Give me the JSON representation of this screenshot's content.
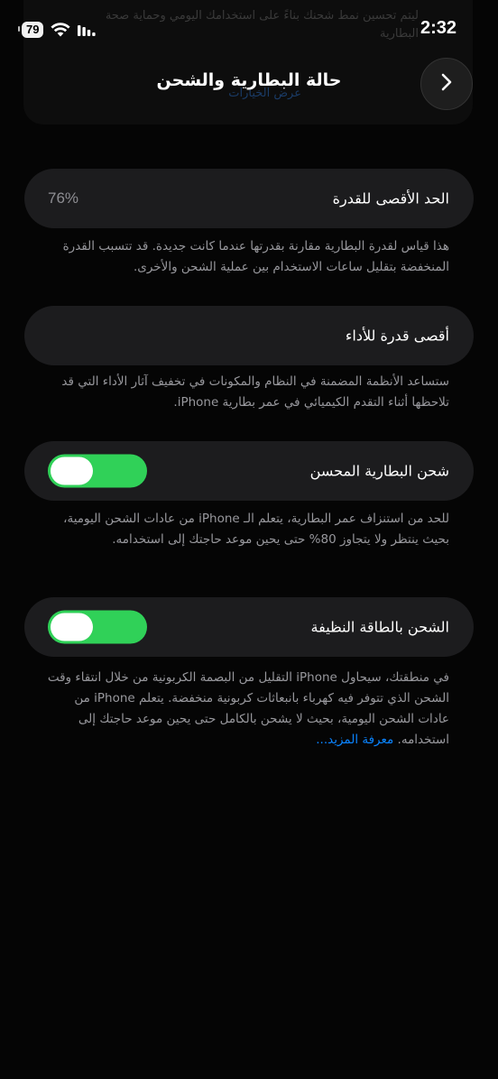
{
  "status_bar": {
    "time": "2:32",
    "battery_level": "79"
  },
  "backdrop": {
    "text": "ليتم تحسين نمط شحنك بناءً على استخدامك اليومي وحماية صحة البطارية",
    "link": "عرض الخيارات"
  },
  "header": {
    "title": "حالة البطارية والشحن"
  },
  "max_capacity": {
    "label": "الحد الأقصى للقدرة",
    "value": "76%",
    "note": "هذا قياس لقدرة البطارية مقارنة بقدرتها عندما كانت جديدة. قد تتسبب القدرة المنخفضة بتقليل ساعات الاستخدام بين عملية الشحن والأخرى."
  },
  "peak_performance": {
    "label": "أقصى قدرة للأداء",
    "note": "ستساعد الأنظمة المضمنة في النظام والمكونات في تخفيف آثار الأداء التي قد تلاحظها أثناء التقدم الكيميائي في عمر بطارية iPhone."
  },
  "optimized_charging": {
    "label": "شحن البطارية المحسن",
    "enabled": true,
    "note": "للحد من استنزاف عمر البطارية، يتعلم الـ iPhone من عادات الشحن اليومية، بحيث ينتظر ولا يتجاوز 80% حتى يحين موعد حاجتك إلى استخدامه."
  },
  "clean_energy": {
    "label": "الشحن بالطاقة النظيفة",
    "enabled": true,
    "note": "في منطقتك، سيحاول iPhone التقليل من البصمة الكربونية من خلال انتقاء وقت الشحن الذي تتوفر فيه كهرباء بانبعاثات كربونية منخفضة. يتعلم iPhone من عادات الشحن اليومية، بحيث لا يشحن بالكامل حتى يحين موعد حاجتك إلى استخدامه.",
    "learn_more": "معرفة المزيد..."
  },
  "colors": {
    "background": "#050505",
    "row": "#1c1c1e",
    "toggle_on": "#30d158",
    "link": "#0a84ff",
    "secondary_text": "#98989d"
  },
  "icons": {
    "back": "chevron-right-icon",
    "wifi": "wifi-icon",
    "signal": "cellular-signal-icon"
  }
}
